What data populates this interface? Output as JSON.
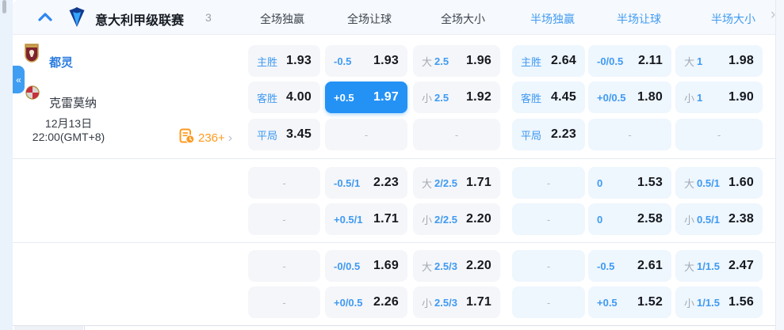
{
  "header": {
    "league": "意大利甲级联赛",
    "count": "3",
    "columns": [
      "全场独赢",
      "全场让球",
      "全场大小",
      "半场独赢",
      "半场让球",
      "半场大小"
    ]
  },
  "sidebar": {
    "collapse_glyph": "«"
  },
  "icons": {
    "chevron_right": "›",
    "header_chevron_right": "›"
  },
  "match": {
    "home": "都灵",
    "away": "克雷莫纳",
    "date": "12月13日",
    "time": "22:00(GMT+8)",
    "more_markets": "236+"
  },
  "colors": {
    "accent_blue": "#3f9af2",
    "selected_cell": "#2492f5",
    "orange": "#ff9a1f",
    "cell_gray": "#f5f6f9",
    "cell_blue": "#eef6fe",
    "home_team_blue": "#2b7de0"
  },
  "odds_groups": [
    {
      "rows": [
        [
          {
            "label": "主胜",
            "odds": "1.93"
          },
          {
            "line": "-0.5",
            "odds": "1.93"
          },
          {
            "pre": "大",
            "line": "2.5",
            "odds": "1.96"
          },
          {
            "label": "主胜",
            "odds": "2.64"
          },
          {
            "line": "-0/0.5",
            "odds": "2.11"
          },
          {
            "pre": "大",
            "line": "1",
            "odds": "1.98"
          }
        ],
        [
          {
            "label": "客胜",
            "odds": "4.00"
          },
          {
            "line": "+0.5",
            "odds": "1.97",
            "selected": true
          },
          {
            "pre": "小",
            "line": "2.5",
            "odds": "1.92"
          },
          {
            "label": "客胜",
            "odds": "4.45"
          },
          {
            "line": "+0/0.5",
            "odds": "1.80"
          },
          {
            "pre": "小",
            "line": "1",
            "odds": "1.90"
          }
        ],
        [
          {
            "label": "平局",
            "odds": "3.45"
          },
          {
            "dash": "-"
          },
          {
            "dash": "-"
          },
          {
            "label": "平局",
            "odds": "2.23"
          },
          {
            "dash": "-"
          },
          {
            "dash": "-"
          }
        ]
      ]
    },
    {
      "rows": [
        [
          {
            "dash": "-"
          },
          {
            "line": "-0.5/1",
            "odds": "2.23"
          },
          {
            "pre": "大",
            "line": "2/2.5",
            "odds": "1.71"
          },
          {
            "dash": "-"
          },
          {
            "line": "0",
            "odds": "1.53"
          },
          {
            "pre": "大",
            "line": "0.5/1",
            "odds": "1.60"
          }
        ],
        [
          {
            "dash": "-"
          },
          {
            "line": "+0.5/1",
            "odds": "1.71"
          },
          {
            "pre": "小",
            "line": "2/2.5",
            "odds": "2.20"
          },
          {
            "dash": "-"
          },
          {
            "line": "0",
            "odds": "2.58"
          },
          {
            "pre": "小",
            "line": "0.5/1",
            "odds": "2.38"
          }
        ]
      ]
    },
    {
      "rows": [
        [
          {
            "dash": "-"
          },
          {
            "line": "-0/0.5",
            "odds": "1.69"
          },
          {
            "pre": "大",
            "line": "2.5/3",
            "odds": "2.20"
          },
          {
            "dash": "-"
          },
          {
            "line": "-0.5",
            "odds": "2.61"
          },
          {
            "pre": "大",
            "line": "1/1.5",
            "odds": "2.47"
          }
        ],
        [
          {
            "dash": "-"
          },
          {
            "line": "+0/0.5",
            "odds": "2.26"
          },
          {
            "pre": "小",
            "line": "2.5/3",
            "odds": "1.71"
          },
          {
            "dash": "-"
          },
          {
            "line": "+0.5",
            "odds": "1.52"
          },
          {
            "pre": "小",
            "line": "1/1.5",
            "odds": "1.56"
          }
        ]
      ]
    }
  ]
}
